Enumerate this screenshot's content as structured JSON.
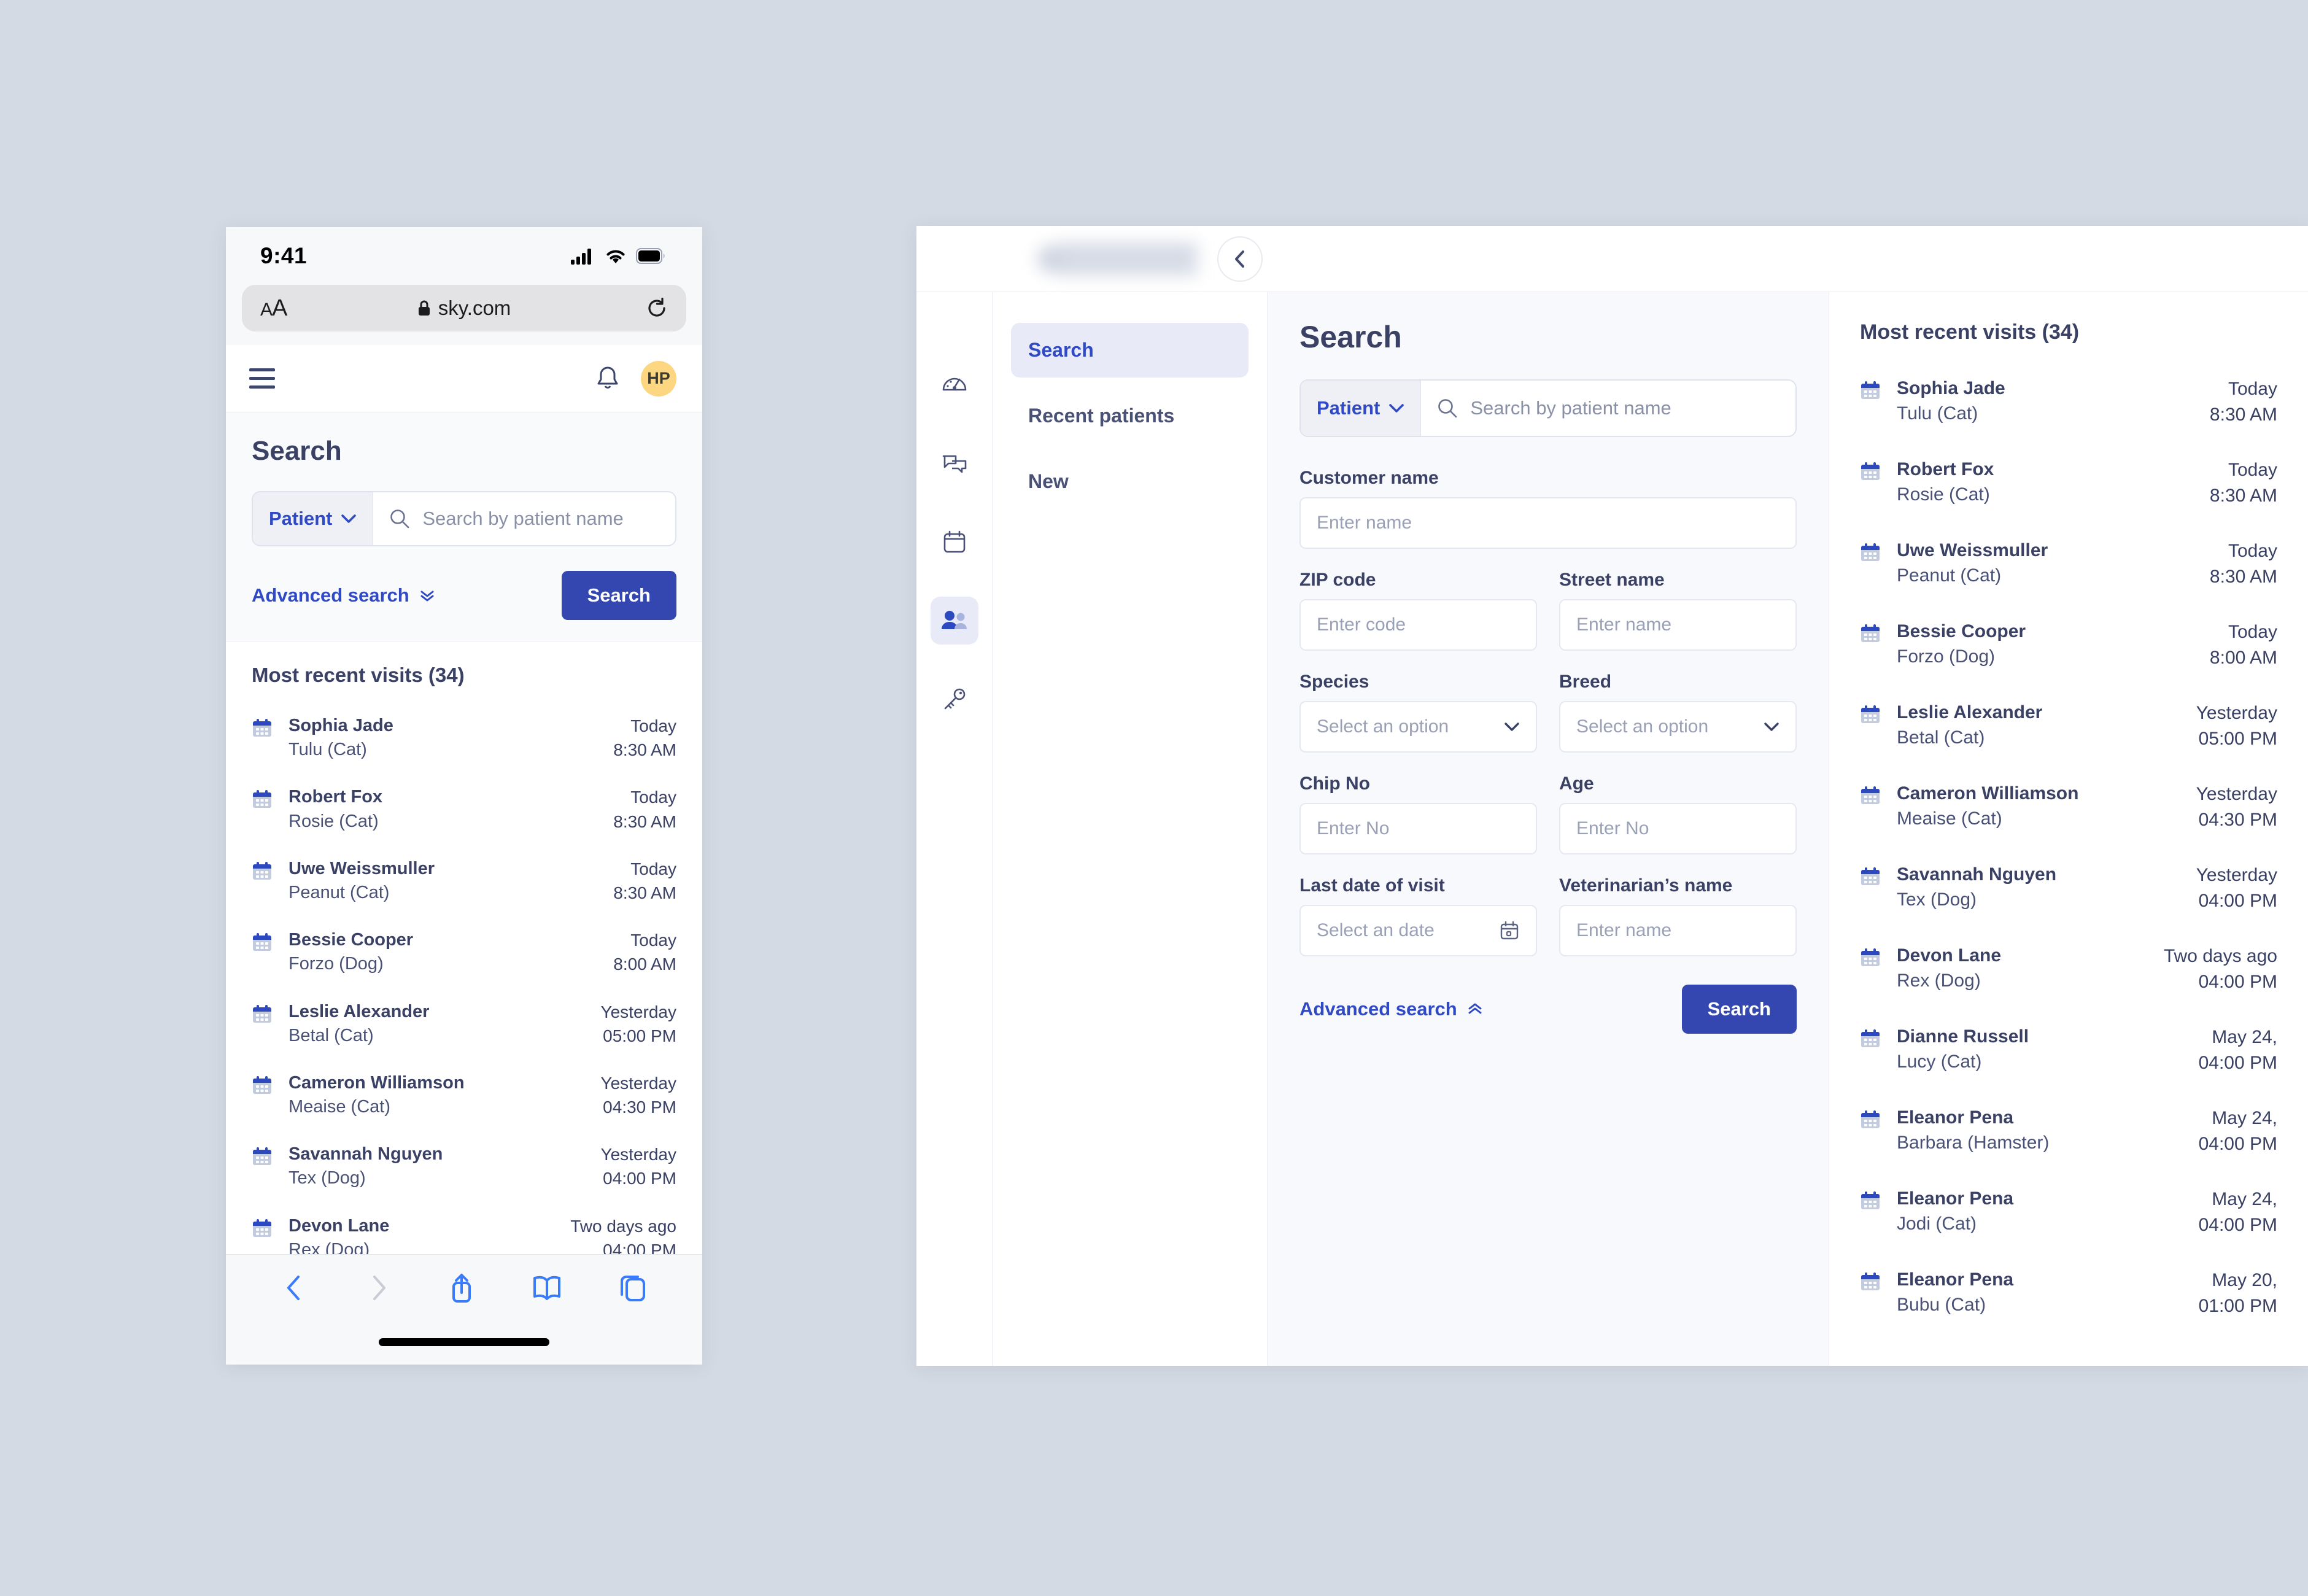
{
  "mobile": {
    "status": {
      "time": "9:41",
      "signal_icon": "cellular-signal-icon",
      "wifi_icon": "wifi-icon",
      "battery_icon": "battery-icon"
    },
    "browser": {
      "text_size_label": "AA",
      "url": "sky.com",
      "lock_icon": "lock-icon",
      "reload_icon": "reload-icon"
    },
    "appbar": {
      "menu_icon": "hamburger-menu-icon",
      "bell_icon": "notification-bell-icon",
      "avatar_initials": "HP"
    },
    "search": {
      "title": "Search",
      "segment_label": "Patient",
      "placeholder": "Search by patient name",
      "advanced_label": "Advanced search",
      "search_button": "Search"
    },
    "list_title": "Most recent visits (34)",
    "bottombar": {
      "back_icon": "chevron-left-icon",
      "forward_icon": "chevron-right-icon",
      "share_icon": "share-icon",
      "bookmarks_icon": "book-icon",
      "tabs_icon": "tabs-icon"
    }
  },
  "desktop": {
    "header": {
      "logo": "app-logo-blurred",
      "back_icon": "chevron-left-icon"
    },
    "rail": [
      {
        "name": "dashboard",
        "icon": "speedometer-icon",
        "active": false
      },
      {
        "name": "messages",
        "icon": "chat-bubbles-icon",
        "active": false
      },
      {
        "name": "calendar",
        "icon": "calendar-icon",
        "active": false
      },
      {
        "name": "patients",
        "icon": "people-icon",
        "active": true
      },
      {
        "name": "access",
        "icon": "key-icon",
        "active": false
      }
    ],
    "subnav": [
      {
        "label": "Search",
        "active": true
      },
      {
        "label": "Recent patients",
        "active": false
      },
      {
        "label": "New",
        "active": false
      }
    ],
    "form": {
      "title": "Search",
      "segment_label": "Patient",
      "search_placeholder": "Search by patient name",
      "fields": [
        {
          "label": "Customer name",
          "placeholder": "Enter name",
          "type": "text",
          "full": true
        },
        {
          "label": "ZIP code",
          "placeholder": "Enter code",
          "type": "text"
        },
        {
          "label": "Street name",
          "placeholder": "Enter name",
          "type": "text"
        },
        {
          "label": "Species",
          "placeholder": "Select an option",
          "type": "select"
        },
        {
          "label": "Breed",
          "placeholder": "Select an option",
          "type": "select"
        },
        {
          "label": "Chip No",
          "placeholder": "Enter No",
          "type": "text"
        },
        {
          "label": "Age",
          "placeholder": "Enter No",
          "type": "text"
        },
        {
          "label": "Last date of visit",
          "placeholder": "Select an date",
          "type": "date"
        },
        {
          "label": "Veterinarian’s name",
          "placeholder": "Enter name",
          "type": "text"
        }
      ],
      "advanced_label": "Advanced search",
      "search_button": "Search"
    },
    "list_title": "Most recent visits (34)"
  },
  "visits": [
    {
      "owner": "Sophia Jade",
      "pet": "Tulu (Cat)",
      "when": "Today",
      "time": "8:30 AM"
    },
    {
      "owner": "Robert Fox",
      "pet": "Rosie (Cat)",
      "when": "Today",
      "time": "8:30 AM"
    },
    {
      "owner": "Uwe Weissmuller",
      "pet": "Peanut (Cat)",
      "when": "Today",
      "time": "8:30 AM"
    },
    {
      "owner": "Bessie Cooper",
      "pet": "Forzo (Dog)",
      "when": "Today",
      "time": "8:00 AM"
    },
    {
      "owner": "Leslie Alexander",
      "pet": "Betal (Cat)",
      "when": "Yesterday",
      "time": "05:00 PM"
    },
    {
      "owner": "Cameron Williamson",
      "pet": "Meaise (Cat)",
      "when": "Yesterday",
      "time": "04:30 PM"
    },
    {
      "owner": "Savannah Nguyen",
      "pet": "Tex (Dog)",
      "when": "Yesterday",
      "time": "04:00 PM"
    },
    {
      "owner": "Devon Lane",
      "pet": "Rex (Dog)",
      "when": "Two days ago",
      "time": "04:00 PM"
    },
    {
      "owner": "Dianne Russell",
      "pet": "Lucy (Cat)",
      "when": "May 24,",
      "time": "04:00 PM"
    },
    {
      "owner": "Eleanor Pena",
      "pet": "Barbara (Hamster)",
      "when": "May 24,",
      "time": "04:00 PM"
    },
    {
      "owner": "Eleanor Pena",
      "pet": "Jodi (Cat)",
      "when": "May 24,",
      "time": "04:00 PM"
    },
    {
      "owner": "Eleanor Pena",
      "pet": "Bubu (Cat)",
      "when": "May 20,",
      "time": "01:00 PM"
    }
  ],
  "colors": {
    "page_bg": "#d3dae3",
    "accent_blue": "#3049c4",
    "button_blue": "#3447b0",
    "ink": "#3a4164",
    "panel_bg": "#f8f9fc",
    "avatar_yellow": "#fcd680"
  }
}
